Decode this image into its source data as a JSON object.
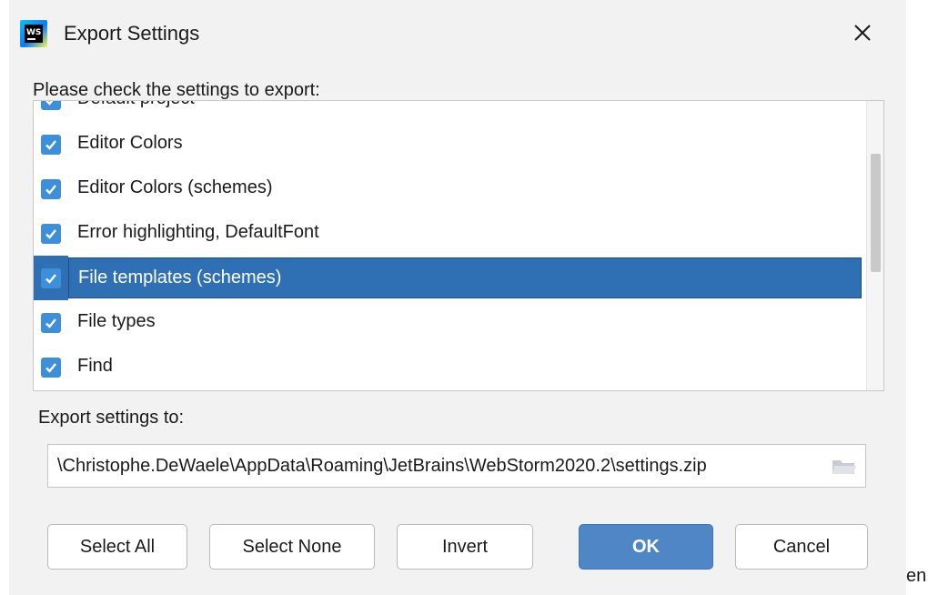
{
  "window": {
    "title": "Export Settings",
    "app_icon_text": "WS"
  },
  "prompt": "Please check the settings to export:",
  "items": [
    {
      "label": "Default project",
      "checked": true,
      "selected": false
    },
    {
      "label": "Editor Colors",
      "checked": true,
      "selected": false
    },
    {
      "label": "Editor Colors (schemes)",
      "checked": true,
      "selected": false
    },
    {
      "label": "Error highlighting, DefaultFont",
      "checked": true,
      "selected": false
    },
    {
      "label": "File templates (schemes)",
      "checked": true,
      "selected": true
    },
    {
      "label": "File types",
      "checked": true,
      "selected": false
    },
    {
      "label": "Find",
      "checked": true,
      "selected": false
    }
  ],
  "export": {
    "label": "Export settings to:",
    "path": "\\Christophe.DeWaele\\AppData\\Roaming\\JetBrains\\WebStorm2020.2\\settings.zip"
  },
  "buttons": {
    "select_all": "Select All",
    "select_none": "Select None",
    "invert": "Invert",
    "ok": "OK",
    "cancel": "Cancel"
  },
  "trailing_text": "en.",
  "colors": {
    "accent": "#3d8fd9",
    "selection": "#2f70b5",
    "ok_button": "#4f86c6"
  }
}
